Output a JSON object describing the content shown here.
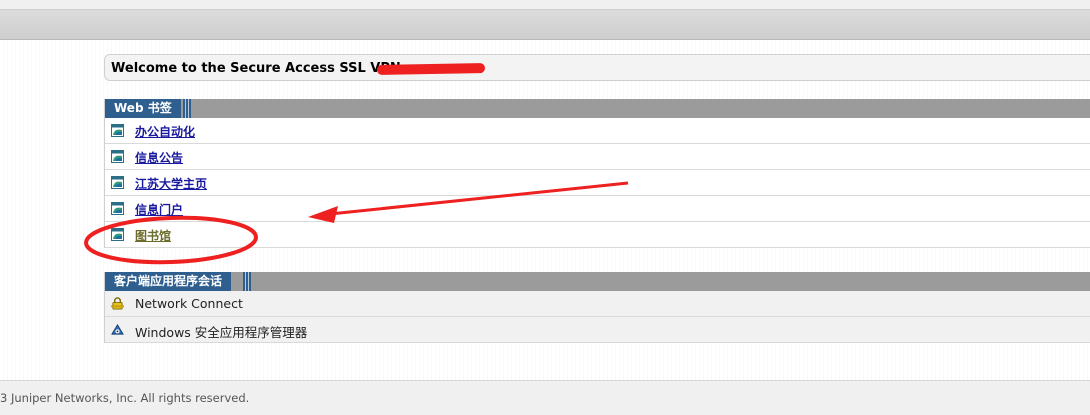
{
  "welcome": {
    "text": "Welcome to the Secure Access SSL VPN, "
  },
  "bookmarks": {
    "title": "Web 书签",
    "items": [
      {
        "label": "办公自动化",
        "icon": "web-bookmark-icon"
      },
      {
        "label": "信息公告",
        "icon": "web-bookmark-icon"
      },
      {
        "label": "江苏大学主页",
        "icon": "web-bookmark-icon"
      },
      {
        "label": "信息门户",
        "icon": "web-bookmark-icon"
      },
      {
        "label": "图书馆",
        "icon": "web-bookmark-icon"
      }
    ]
  },
  "apps": {
    "title": "客户端应用程序会话",
    "items": [
      {
        "label": "Network Connect",
        "icon": "network-connect-icon"
      },
      {
        "label": "Windows 安全应用程序管理器",
        "icon": "secure-app-manager-icon"
      }
    ]
  },
  "footer": {
    "text": "3 Juniper Networks, Inc. All rights reserved."
  },
  "colors": {
    "section_tab": "#2f5f8f",
    "section_bar": "#9b9b9b",
    "link": "#1a1aa0",
    "annotation": "#ee2020"
  }
}
